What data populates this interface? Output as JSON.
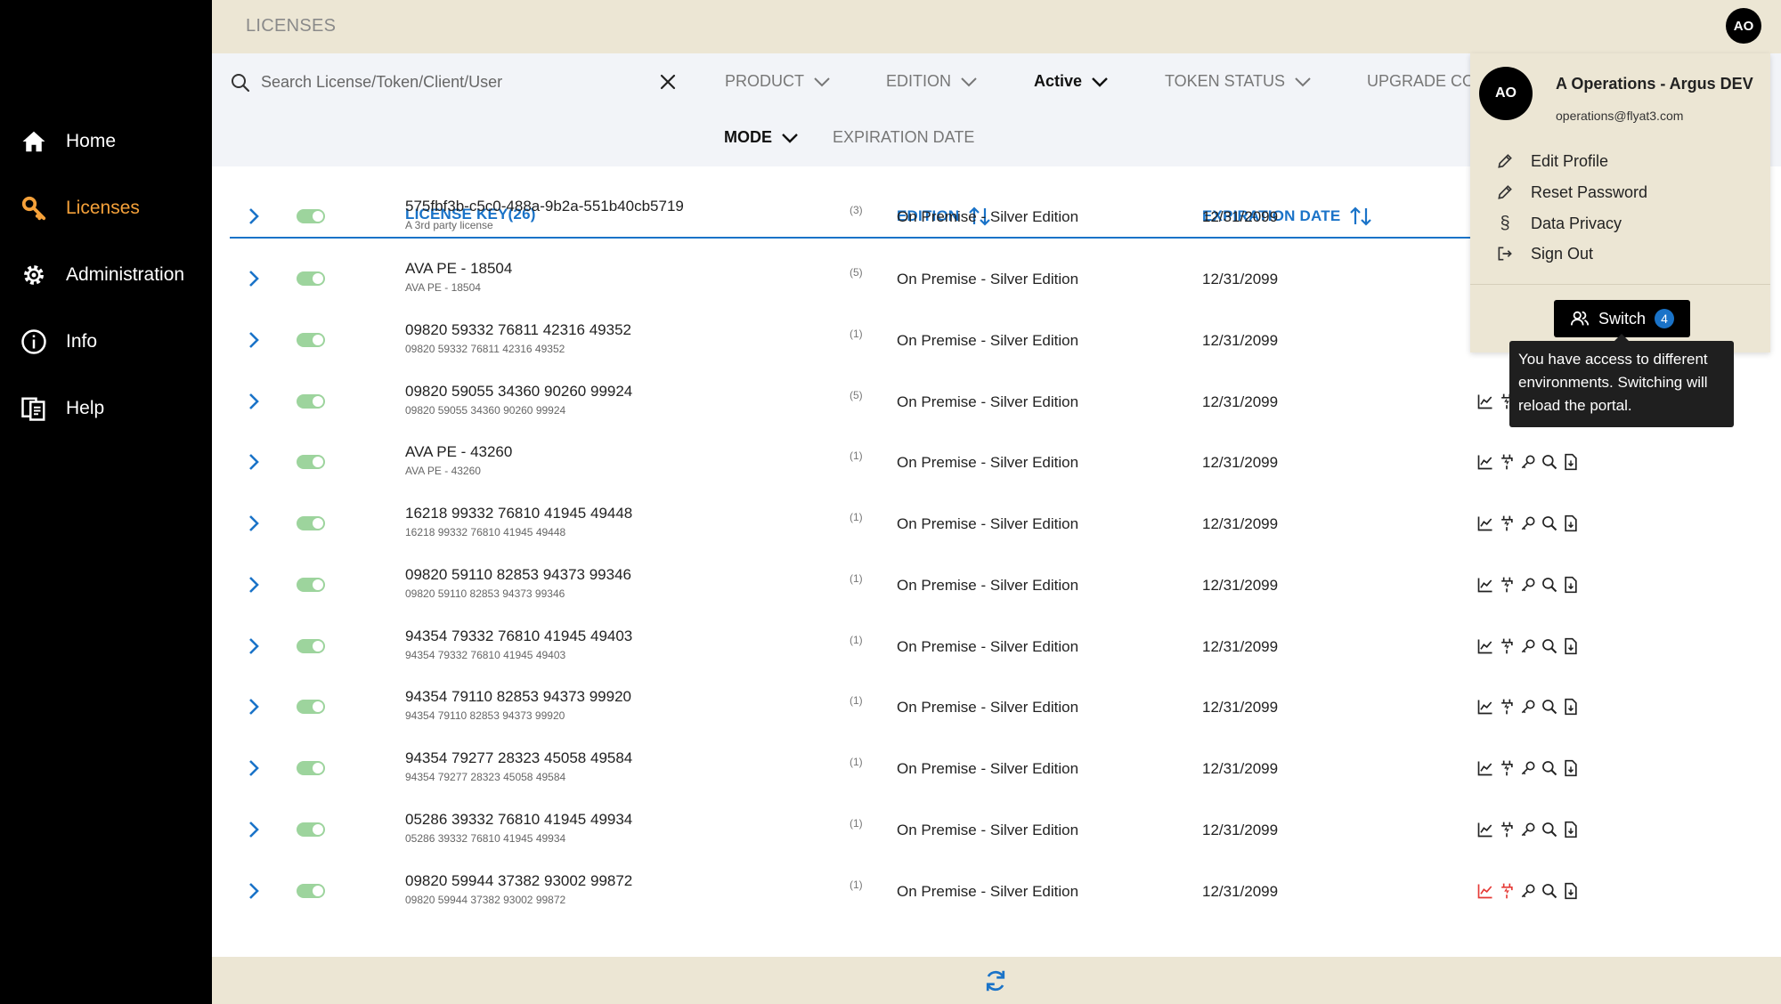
{
  "sidebar": {
    "items": [
      {
        "label": "Home",
        "icon": "home-icon"
      },
      {
        "label": "Licenses",
        "icon": "key-icon",
        "active": true
      },
      {
        "label": "Administration",
        "icon": "gear-icon"
      },
      {
        "label": "Info",
        "icon": "info-icon"
      },
      {
        "label": "Help",
        "icon": "help-icon"
      }
    ],
    "active_color": "#f5a13a"
  },
  "header": {
    "title": "LICENSES",
    "avatar_initials": "AO"
  },
  "filters": {
    "search_placeholder": "Search License/Token/Client/User",
    "product": "PRODUCT",
    "edition": "EDITION",
    "status": "Active",
    "token_status": "TOKEN STATUS",
    "upgrade": "UPGRADE CO",
    "mode": "MODE",
    "expiration_date": "EXPIRATION DATE"
  },
  "table": {
    "headers": {
      "license_key": "LICENSE KEY(26)",
      "edition": "EDITION",
      "expiration_date": "EXPIRATION DATE"
    },
    "rows": [
      {
        "key": "575fbf3b-c5c0-488a-9b2a-551b40cb5719",
        "sub": "A 3rd party license",
        "count": "(3)",
        "edition": "On Premise - Silver Edition",
        "date": "12/31/2099",
        "actions_hidden": true
      },
      {
        "key": "AVA PE - 18504",
        "sub": "AVA PE - 18504",
        "count": "(5)",
        "edition": "On Premise - Silver Edition",
        "date": "12/31/2099",
        "actions_hidden": true
      },
      {
        "key": "09820 59332 76811 42316 49352",
        "sub": "09820 59332 76811 42316 49352",
        "count": "(1)",
        "edition": "On Premise - Silver Edition",
        "date": "12/31/2099",
        "actions_partial": true
      },
      {
        "key": "09820 59055 34360 90260 99924",
        "sub": "09820 59055 34360 90260 99924",
        "count": "(5)",
        "edition": "On Premise - Silver Edition",
        "date": "12/31/2099"
      },
      {
        "key": "AVA PE - 43260",
        "sub": "AVA PE - 43260",
        "count": "(1)",
        "edition": "On Premise - Silver Edition",
        "date": "12/31/2099"
      },
      {
        "key": "16218 99332 76810 41945 49448",
        "sub": "16218 99332 76810 41945 49448",
        "count": "(1)",
        "edition": "On Premise - Silver Edition",
        "date": "12/31/2099"
      },
      {
        "key": "09820 59110 82853 94373 99346",
        "sub": "09820 59110 82853 94373 99346",
        "count": "(1)",
        "edition": "On Premise - Silver Edition",
        "date": "12/31/2099"
      },
      {
        "key": "94354 79332 76810 41945 49403",
        "sub": "94354 79332 76810 41945 49403",
        "count": "(1)",
        "edition": "On Premise - Silver Edition",
        "date": "12/31/2099"
      },
      {
        "key": "94354 79110 82853 94373 99920",
        "sub": "94354 79110 82853 94373 99920",
        "count": "(1)",
        "edition": "On Premise - Silver Edition",
        "date": "12/31/2099"
      },
      {
        "key": "94354 79277 28323 45058 49584",
        "sub": "94354 79277 28323 45058 49584",
        "count": "(1)",
        "edition": "On Premise - Silver Edition",
        "date": "12/31/2099"
      },
      {
        "key": "05286 39332 76810 41945 49934",
        "sub": "05286 39332 76810 41945 49934",
        "count": "(1)",
        "edition": "On Premise - Silver Edition",
        "date": "12/31/2099"
      },
      {
        "key": "09820 59944 37382 93002 99872",
        "sub": "09820 59944 37382 93002 99872",
        "count": "(1)",
        "edition": "On Premise - Silver Edition",
        "date": "12/31/2099",
        "warning": true
      }
    ],
    "accent_color": "#1a73c8",
    "warning_color": "#e53935"
  },
  "profile_menu": {
    "initials": "AO",
    "name": "A Operations - Argus DEV",
    "email": "operations@flyat3.com",
    "items": [
      {
        "label": "Edit Profile",
        "icon": "pencil-icon"
      },
      {
        "label": "Reset Password",
        "icon": "pencil-icon"
      },
      {
        "label": "Data Privacy",
        "icon": "section-icon"
      },
      {
        "label": "Sign Out",
        "icon": "sign-out-icon"
      }
    ],
    "switch_label": "Switch",
    "switch_count": "4",
    "tooltip": "You have access to different environments. Switching will reload the portal."
  }
}
